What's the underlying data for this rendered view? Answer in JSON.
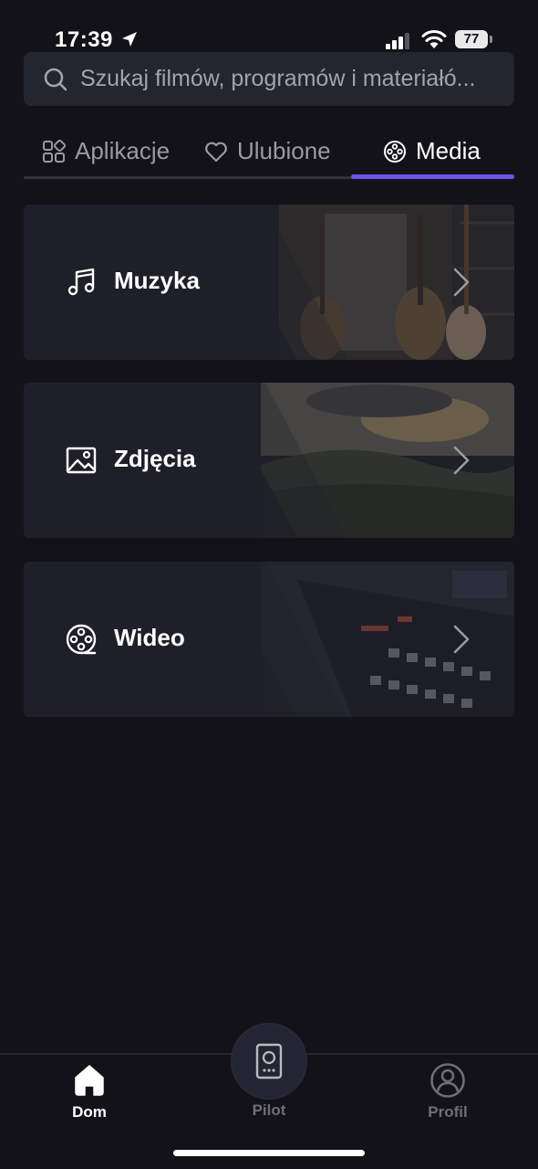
{
  "status_bar": {
    "time": "17:39",
    "battery": "77"
  },
  "search": {
    "placeholder": "Szukaj filmów, programów i materiałó..."
  },
  "tabs": [
    {
      "label": "Aplikacje",
      "icon": "apps-grid-icon",
      "active": false
    },
    {
      "label": "Ulubione",
      "icon": "heart-icon",
      "active": false
    },
    {
      "label": "Media",
      "icon": "film-reel-icon",
      "active": true
    }
  ],
  "media": [
    {
      "label": "Muzyka",
      "icon": "music-note-icon"
    },
    {
      "label": "Zdjęcia",
      "icon": "image-icon"
    },
    {
      "label": "Wideo",
      "icon": "film-reel-icon"
    }
  ],
  "bottom_nav": {
    "home": {
      "label": "Dom",
      "icon": "home-icon",
      "active": true
    },
    "pilot": {
      "label": "Pilot",
      "icon": "remote-icon",
      "active": false
    },
    "profile": {
      "label": "Profil",
      "icon": "profile-icon",
      "active": false
    }
  },
  "colors": {
    "background": "#131219",
    "accent": "#6b54e8",
    "card": "#1f2028",
    "inactive_text": "#9a9aa3"
  }
}
